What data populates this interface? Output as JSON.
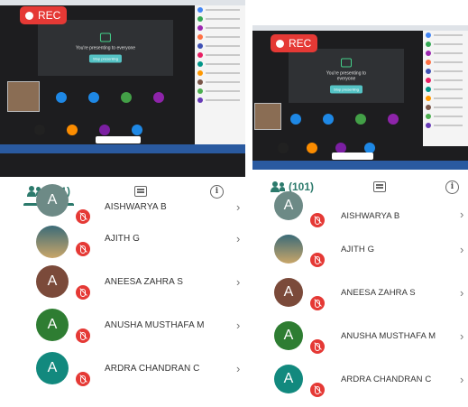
{
  "recording": {
    "label": "REC"
  },
  "meeting": {
    "presenting_text": "You're presenting to everyone",
    "stop_button": "Stop presenting"
  },
  "tabs": {
    "people_count": "(101)"
  },
  "participants": [
    {
      "name": "AISHWARYA B",
      "initial": "A",
      "avatar_color": "#6d8a86",
      "muted": true
    },
    {
      "name": "AJITH G",
      "initial": "",
      "avatar_color": "#9c8a6a",
      "muted": true
    },
    {
      "name": "ANEESA ZAHRA S",
      "initial": "A",
      "avatar_color": "#7b4a3a",
      "muted": true
    },
    {
      "name": "ANUSHA MUSTHAFA M",
      "initial": "A",
      "avatar_color": "#2e7d32",
      "muted": true
    },
    {
      "name": "ARDRA CHANDRAN C",
      "initial": "A",
      "avatar_color": "#12897e",
      "muted": true
    }
  ],
  "colors": {
    "accent": "#2c7a6c",
    "mute": "#e53935",
    "rec": "#e53935"
  }
}
